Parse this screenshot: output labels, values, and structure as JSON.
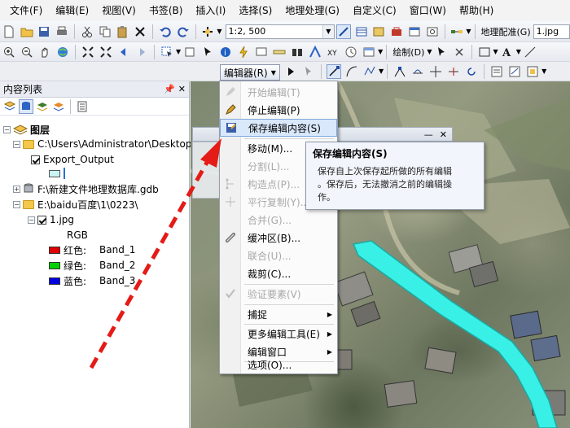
{
  "menubar": {
    "items": [
      "文件(F)",
      "编辑(E)",
      "视图(V)",
      "书签(B)",
      "插入(I)",
      "选择(S)",
      "地理处理(G)",
      "自定义(C)",
      "窗口(W)",
      "帮助(H)"
    ]
  },
  "toolbar": {
    "scale_value": "1:2, 500",
    "georef_label": "地理配准(G)",
    "georef_layer": "1.jpg",
    "draw_label": "绘制(D)",
    "editor_label": "编辑器(R)"
  },
  "toc": {
    "title": "内容列表",
    "root_label": "图层",
    "items": [
      {
        "label": "C:\\Users\\Administrator\\Desktop\\a"
      },
      {
        "label": "Export_Output"
      },
      {
        "label": "F:\\新建文件地理数据库.gdb"
      },
      {
        "label": "E:\\baidu百度\\1\\0223\\"
      },
      {
        "label": "1.jpg"
      },
      {
        "label": "RGB"
      }
    ],
    "bands": [
      {
        "name": "红色:",
        "band": "Band_1",
        "color": "#e00000"
      },
      {
        "name": "绿色:",
        "band": "Band_2",
        "color": "#00d000"
      },
      {
        "name": "蓝色:",
        "band": "Band_3",
        "color": "#0000e0"
      }
    ]
  },
  "editor_menu": {
    "items": [
      {
        "label": "开始编辑(T)",
        "disabled": true
      },
      {
        "label": "停止编辑(P)",
        "disabled": false
      },
      {
        "label": "保存编辑内容(S)",
        "disabled": false,
        "highlighted": true
      },
      {
        "label": "移动(M)...",
        "disabled": false
      },
      {
        "label": "分割(L)...",
        "disabled": true
      },
      {
        "label": "构造点(P)...",
        "disabled": true
      },
      {
        "label": "平行复制(Y)...",
        "disabled": true
      },
      {
        "label": "合并(G)...",
        "disabled": true
      },
      {
        "label": "缓冲区(B)...",
        "disabled": false
      },
      {
        "label": "联合(U)...",
        "disabled": true
      },
      {
        "label": "裁剪(C)...",
        "disabled": false
      },
      {
        "label": "验证要素(V)",
        "disabled": true
      },
      {
        "label": "捕捉",
        "disabled": false,
        "submenu": true
      },
      {
        "label": "更多编辑工具(E)",
        "disabled": false,
        "submenu": true
      },
      {
        "label": "编辑窗口",
        "disabled": false,
        "submenu": true
      },
      {
        "label": "选项(O)...",
        "disabled": false
      }
    ]
  },
  "tooltip": {
    "title": "保存编辑内容(S)",
    "line1": "保存自上次保存起所做的所有编辑",
    "line2": "。保存后，无法撤消之前的编辑操",
    "line3": "作。"
  },
  "colors": {
    "highlight": "#d9e8fb",
    "feature": "#39f0e6",
    "annotation_arrow": "#e41b17"
  }
}
